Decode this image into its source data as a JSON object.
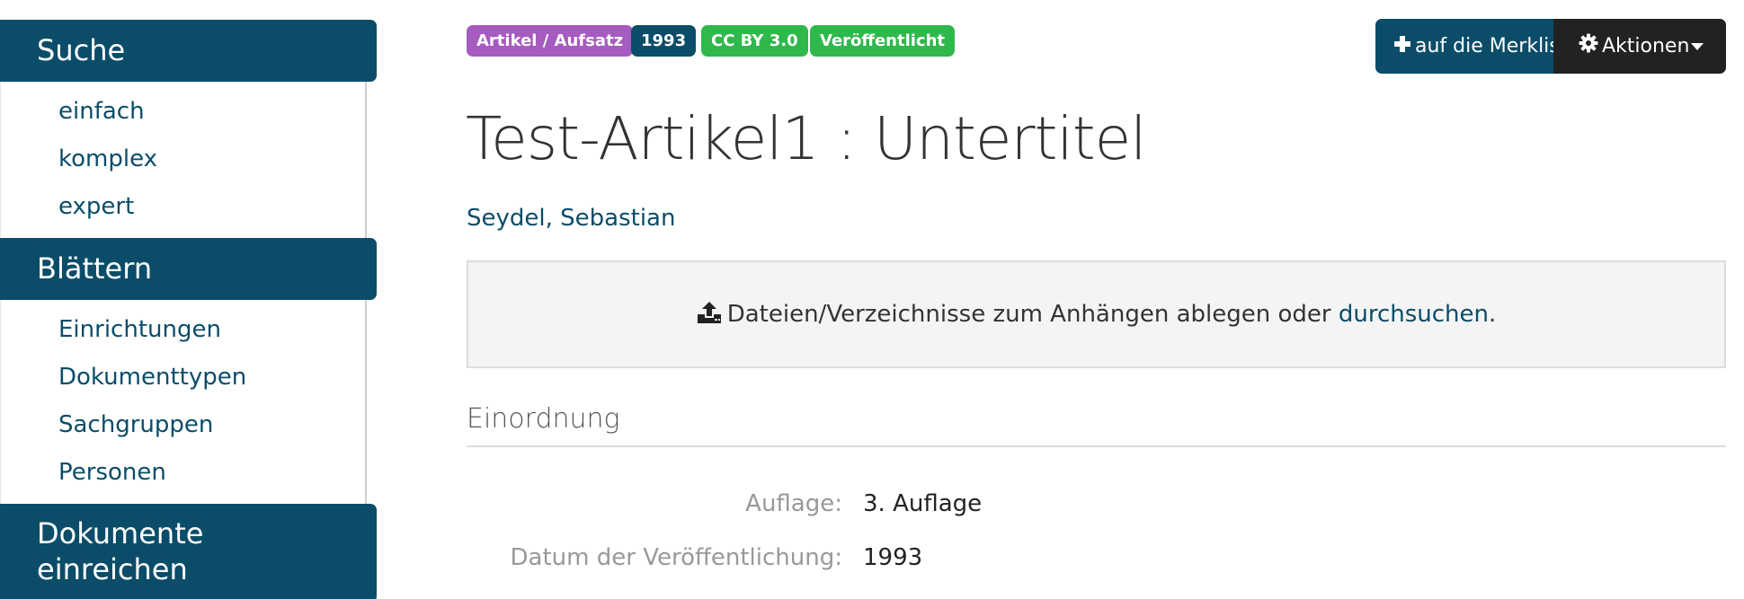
{
  "sidebar": {
    "sections": [
      {
        "title": "Suche",
        "items": [
          "einfach",
          "komplex",
          "expert"
        ]
      },
      {
        "title": "Blättern",
        "items": [
          "Einrichtungen",
          "Dokumenttypen",
          "Sachgruppen",
          "Personen"
        ]
      },
      {
        "title_lines": [
          "Dokumente",
          "einreichen"
        ]
      }
    ]
  },
  "badges": [
    {
      "label": "Artikel / Aufsatz",
      "color": "#a55bbf"
    },
    {
      "label": "1993",
      "color": "#0b4d69"
    },
    {
      "label": "CC BY 3.0",
      "color": "#2fb84b"
    },
    {
      "label": "Veröffentlicht",
      "color": "#2fb84b"
    }
  ],
  "actions": {
    "merkliste_label": "auf die Merkliste",
    "aktionen_label": "Aktionen",
    "merkliste_icon": "plus-icon",
    "aktionen_icon": "gear-icon"
  },
  "document": {
    "title": "Test-Artikel1 : Untertitel",
    "author": "Seydel, Sebastian"
  },
  "dropzone": {
    "text": "Dateien/Verzeichnisse zum Anhängen ablegen oder ",
    "link": "durchsuchen",
    "suffix": ".",
    "icon": "upload-icon"
  },
  "einordnung": {
    "heading": "Einordnung",
    "fields": [
      {
        "label": "Auflage:",
        "value": "3. Auflage"
      },
      {
        "label": "Datum der Veröffentlichung:",
        "value": "1993"
      }
    ]
  },
  "colors": {
    "brand": "#0b4d69",
    "dark_button": "#222222"
  }
}
